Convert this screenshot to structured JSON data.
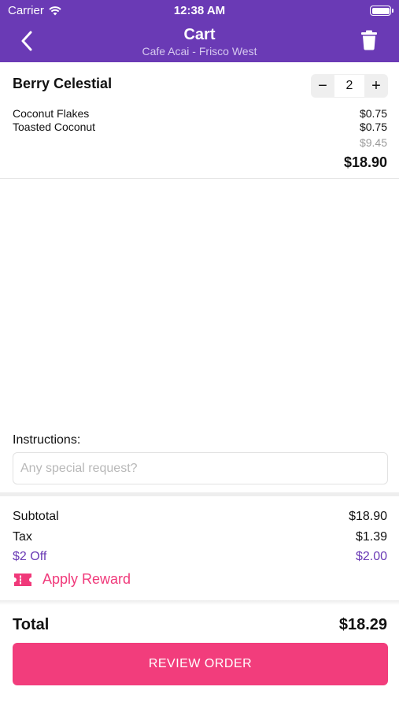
{
  "status_bar": {
    "carrier": "Carrier",
    "time": "12:38 AM"
  },
  "nav": {
    "title": "Cart",
    "subtitle": "Cafe Acai - Frisco West",
    "icons": {
      "back": "chevron-left-icon",
      "trash": "trash-icon"
    }
  },
  "item": {
    "name": "Berry Celestial",
    "quantity": "2",
    "minus": "−",
    "plus": "+",
    "modifiers": [
      {
        "name": "Coconut Flakes",
        "price": "$0.75"
      },
      {
        "name": "Toasted Coconut",
        "price": "$0.75"
      }
    ],
    "base_price": "$9.45",
    "line_total": "$18.90"
  },
  "instructions": {
    "label": "Instructions:",
    "placeholder": "Any special request?"
  },
  "summary": {
    "subtotal_label": "Subtotal",
    "subtotal_value": "$18.90",
    "tax_label": "Tax",
    "tax_value": "$1.39",
    "discount_label": "$2 Off",
    "discount_value": "$2.00",
    "apply_reward": "Apply Reward"
  },
  "footer": {
    "total_label": "Total",
    "total_value": "$18.29",
    "review_button": "REVIEW ORDER"
  },
  "colors": {
    "header": "#6a3ab5",
    "accent_pink": "#f23d7c",
    "discount_purple": "#6a3ab5"
  }
}
